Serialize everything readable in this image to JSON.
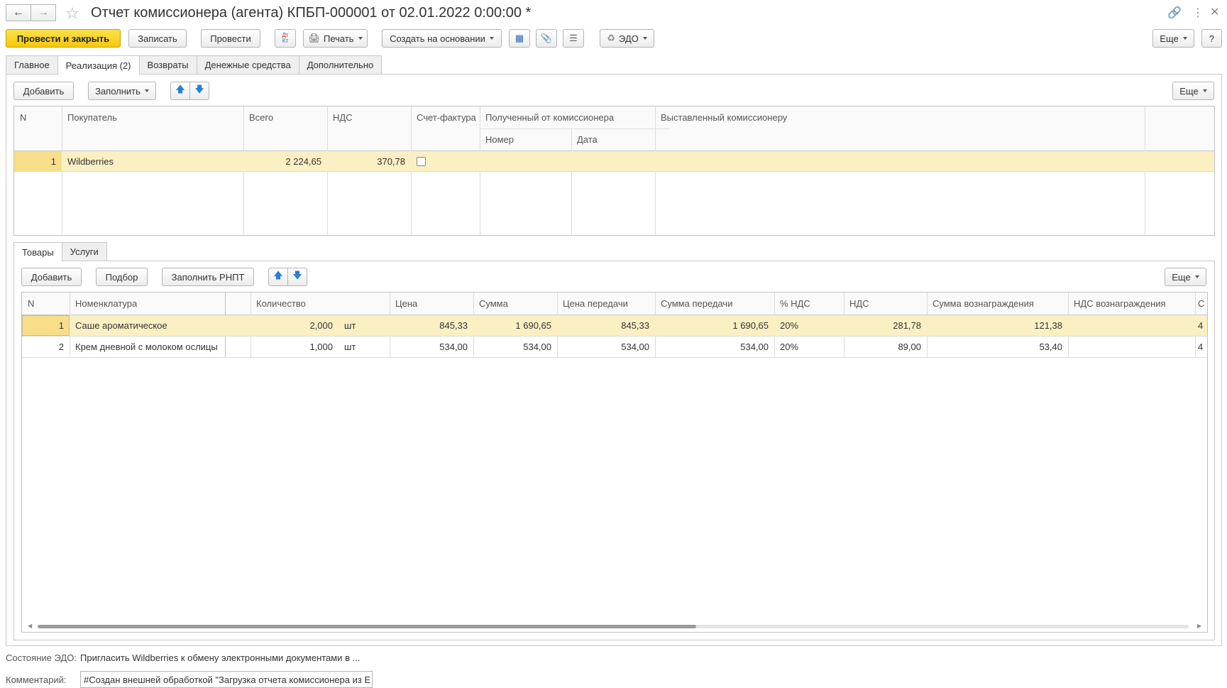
{
  "window": {
    "title": "Отчет комиссионера (агента) КПБП-000001 от 02.01.2022 0:00:00 *"
  },
  "toolbar": {
    "post_close": "Провести и закрыть",
    "save": "Записать",
    "post": "Провести",
    "dtkt_top": "Дт",
    "dtkt_bottom": "Кт",
    "print": "Печать",
    "create_based": "Создать на основании",
    "edo": "ЭДО",
    "more": "Еще",
    "help": "?"
  },
  "tabs": [
    "Главное",
    "Реализация (2)",
    "Возвраты",
    "Денежные средства",
    "Дополнительно"
  ],
  "realization": {
    "add": "Добавить",
    "fill": "Заполнить",
    "more": "Еще",
    "headers": {
      "n": "N",
      "buyer": "Покупатель",
      "total": "Всего",
      "vat": "НДС",
      "invoice": "Счет-фактура",
      "received": "Полученный от комиссионера",
      "received_number": "Номер",
      "received_date": "Дата",
      "issued": "Выставленный комиссионеру"
    },
    "rows": [
      {
        "n": "1",
        "buyer": "Wildberries",
        "total": "2 224,65",
        "vat": "370,78"
      }
    ]
  },
  "subtabs": [
    "Товары",
    "Услуги"
  ],
  "goods": {
    "add": "Добавить",
    "pick": "Подбор",
    "fill_rnpt": "Заполнить РНПТ",
    "more": "Еще",
    "headers": {
      "n": "N",
      "item": "Номенклатура",
      "qty": "Количество",
      "price": "Цена",
      "sum": "Сумма",
      "transfer_price": "Цена передачи",
      "transfer_sum": "Сумма передачи",
      "vat_rate": "% НДС",
      "vat": "НДС",
      "reward_sum": "Сумма вознаграждения",
      "reward_vat": "НДС вознаграждения",
      "next": "С"
    },
    "rows": [
      {
        "n": "1",
        "item": "Саше ароматическое",
        "qty": "2,000",
        "unit": "шт",
        "price": "845,33",
        "sum": "1 690,65",
        "transfer_price": "845,33",
        "transfer_sum": "1 690,65",
        "vat_rate": "20%",
        "vat": "281,78",
        "reward_sum": "121,38",
        "reward_vat": "",
        "next": "4"
      },
      {
        "n": "2",
        "item": "Крем дневной с молоком ослицы",
        "qty": "1,000",
        "unit": "шт",
        "price": "534,00",
        "sum": "534,00",
        "transfer_price": "534,00",
        "transfer_sum": "534,00",
        "vat_rate": "20%",
        "vat": "89,00",
        "reward_sum": "53,40",
        "reward_vat": "",
        "next": "4"
      }
    ]
  },
  "footer": {
    "edo_label": "Состояние ЭДО:",
    "edo_value": "Пригласить Wildberries к обмену электронными документами в ...",
    "comment_label": "Комментарий:",
    "comment_value": "#Создан внешней обработкой \"Загрузка отчета комиссионера из Е"
  }
}
